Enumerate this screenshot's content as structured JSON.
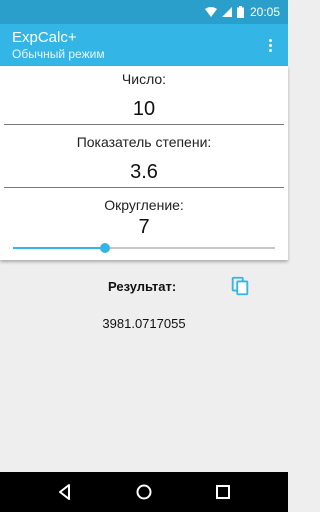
{
  "statusbar": {
    "time": "20:05"
  },
  "appbar": {
    "title": "ExpCalc+",
    "subtitle": "Обычный режим",
    "overflow_icon": "more-vert-icon"
  },
  "colors": {
    "primary": "#33b5e5",
    "status": "#2a9fcb",
    "accent": "#33b5e5"
  },
  "form": {
    "number_label": "Число:",
    "number_value": "10",
    "exponent_label": "Показатель степени:",
    "exponent_value": "3.6",
    "rounding_label": "Округление:",
    "rounding_value": "7",
    "rounding_slider_fraction": 0.35
  },
  "result": {
    "label": "Результат:",
    "value": "3981.0717055",
    "copy_icon": "copy-icon"
  },
  "navbar": {
    "icons": [
      "back-icon",
      "home-icon",
      "recents-icon"
    ]
  }
}
